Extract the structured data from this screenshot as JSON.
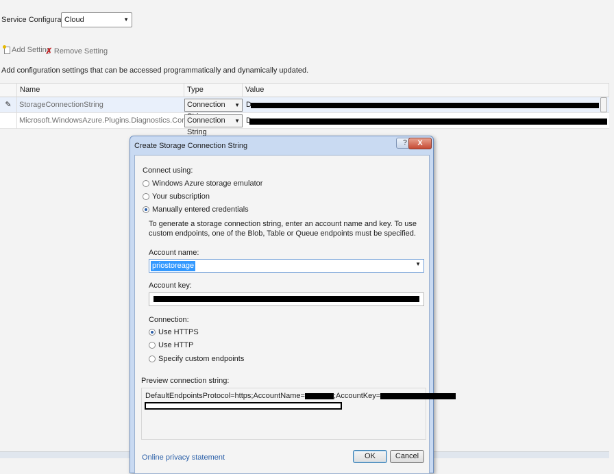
{
  "toolbar": {
    "service_config_label": "Service Configuration:",
    "service_config_value": "Cloud",
    "add_setting": "Add Setting",
    "remove_setting": "Remove Setting"
  },
  "description": "Add configuration settings that can be accessed programmatically and dynamically updated.",
  "grid": {
    "columns": [
      "Name",
      "Type",
      "Value"
    ],
    "rows": [
      {
        "name": "StorageConnectionString",
        "type": "Connection String",
        "value_prefix": "D"
      },
      {
        "name": "Microsoft.WindowsAzure.Plugins.Diagnostics.ConnectionString",
        "type": "Connection String",
        "value_prefix": "D"
      }
    ]
  },
  "dialog": {
    "title": "Create Storage Connection String",
    "help": "?",
    "close": "X",
    "connect_using": "Connect using:",
    "options": [
      "Windows Azure storage emulator",
      "Your subscription",
      "Manually entered credentials"
    ],
    "selected_option": 2,
    "info": "To generate a storage connection string, enter an account name and key.  To use custom endpoints,  one of the Blob, Table or Queue endpoints must be specified.",
    "account_name_label": "Account name:",
    "account_name_value": "priostoreage",
    "account_key_label": "Account key:",
    "connection_label": "Connection:",
    "connection_options": [
      "Use HTTPS",
      "Use HTTP",
      "Specify custom endpoints"
    ],
    "selected_connection": 0,
    "preview_label": "Preview connection string:",
    "preview_text": "DefaultEndpointsProtocol=https;AccountName=",
    "preview_mid": ";AccountKey=",
    "privacy_link": "Online privacy statement",
    "ok": "OK",
    "cancel": "Cancel"
  }
}
